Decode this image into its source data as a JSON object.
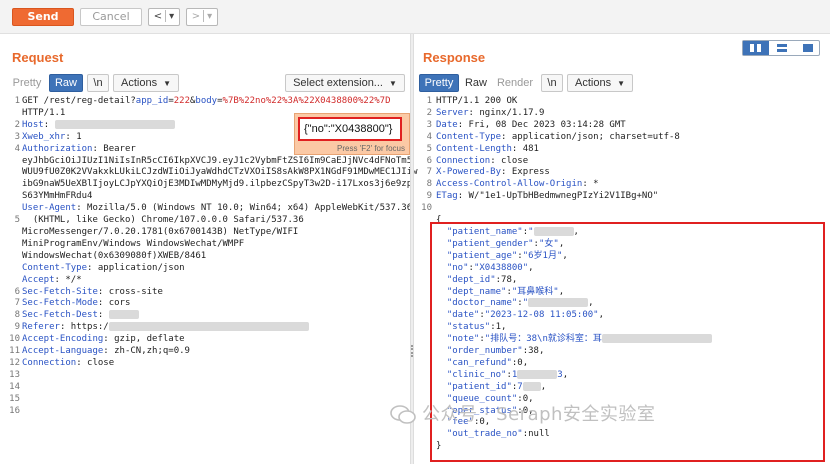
{
  "toolbar": {
    "send_label": "Send",
    "cancel_label": "Cancel",
    "back_label": "<",
    "back_menu_label": "▾",
    "forward_label": ">",
    "forward_menu_label": "▾"
  },
  "request": {
    "title": "Request",
    "tabs": {
      "pretty": "Pretty",
      "raw": "Raw",
      "newline": "\\n",
      "actions": "Actions"
    },
    "select_extension": "Select extension...",
    "tooltip_hint": "Press 'F2' for focus",
    "highlight_text": "{\"no\":\"X0438800\"}",
    "line_numbers": [
      "1",
      "",
      "2",
      "3",
      "4",
      "",
      "",
      "",
      "",
      "",
      "5",
      "",
      "",
      "",
      "",
      "",
      "6",
      "7",
      "8",
      "9",
      "10",
      "11",
      "12",
      "13",
      "14",
      "15",
      "16"
    ],
    "line1_method": "GET /rest/reg-detail?",
    "line1_p1k": "app_id",
    "line1_eq1": "=",
    "line1_p1v": "222",
    "line1_amp": "&",
    "line1_p2k": "body",
    "line1_eq2": "=",
    "line1_p2v": "%7B%22no%22%3A%22X0438800%22%7D",
    "line1b": "HTTP/1.1",
    "host_key": "Host",
    "xweb_key": "Xweb_xhr",
    "xweb_val": " 1",
    "auth_key": "Authorization",
    "auth_val": " Bearer",
    "auth_l2": "eyJhbGciOiJIUzI1NiIsInR5cCI6IkpXVCJ9.eyJ1c2VybmFtZSI6Im9CaEJjNVc4dFNoTm5",
    "auth_l3": "WUU9fU0Z0K2VVakxkLUkiLCJzdWIiOiJyaWdhdCTzVXOiIS8sAkW8PX1NGdF91MDwMEC1JIiw",
    "auth_l4": "ibG9naW5UeXBlIjoyLCJpYXQiOjE3MDIwMDMyMjd9.ilpbezCSpyT3w2D-i17Lxos3j6e9zp",
    "auth_l5": "S63YMmHmFRdu4",
    "ua_key": "User-Agent",
    "ua_l1": " Mozilla/5.0 (Windows NT 10.0; Win64; x64) AppleWebKit/537.36",
    "ua_l2": "  (KHTML, like Gecko) Chrome/107.0.0.0 Safari/537.36",
    "ua_l3": "MicroMessenger/7.0.20.1781(0x6700143B) NetType/WIFI",
    "ua_l4": "MiniProgramEnv/Windows WindowsWechat/WMPF",
    "ua_l5": "WindowsWechat(0x6309080f)XWEB/8461",
    "ct_key": "Content-Type",
    "ct_val": " application/json",
    "accept_key": "Accept",
    "accept_val": " */*",
    "sfs_key": "Sec-Fetch-Site",
    "sfs_val": " cross-site",
    "sfm_key": "Sec-Fetch-Mode",
    "sfm_val": " cors",
    "sfd_key": "Sec-Fetch-Dest",
    "ref_key": "Referer",
    "ref_val": " https:/",
    "ae_key": "Accept-Encoding",
    "ae_val": " gzip, deflate",
    "al_key": "Accept-Language",
    "al_val": " zh-CN,zh;q=0.9",
    "conn_key": "Connection",
    "conn_val": " close"
  },
  "response": {
    "title": "Response",
    "tabs": {
      "pretty": "Pretty",
      "raw": "Raw",
      "render": "Render",
      "newline": "\\n",
      "actions": "Actions"
    },
    "line_numbers": [
      "1",
      "2",
      "3",
      "4",
      "5",
      "6",
      "7",
      "8",
      "9",
      "10",
      "",
      "",
      "",
      "",
      "",
      "",
      "",
      "",
      "",
      "",
      "",
      "",
      "",
      "",
      "",
      "",
      "",
      "",
      ""
    ],
    "status_line": "HTTP/1.1 200 OK",
    "server_key": "Server",
    "server_val": " nginx/1.17.9",
    "date_key": "Date",
    "date_val": " Fri, 08 Dec 2023 03:14:28 GMT",
    "ct_key": "Content-Type",
    "ct_val": " application/json; charset=utf-8",
    "cl_key": "Content-Length",
    "cl_val": " 481",
    "conn_key": "Connection",
    "conn_val": " close",
    "xpb_key": "X-Powered-By",
    "xpb_val": " Express",
    "acao_key": "Access-Control-Allow-Origin",
    "acao_val": " *",
    "etag_key": "ETag",
    "etag_val": " W/\"1e1-UpTbHBedmwnegPIzYi2V1IBg+NO\"",
    "body_open": "{",
    "body_close": "}",
    "json": {
      "patient_name_k": "\"patient_name\"",
      "patient_name_v": "\"",
      "patient_gender_k": "\"patient_gender\"",
      "patient_gender_v": "\"女\"",
      "patient_age_k": "\"patient_age\"",
      "patient_age_v": "\"6岁1月\"",
      "no_k": "\"no\"",
      "no_v": "\"X0438800\"",
      "dept_id_k": "\"dept_id\"",
      "dept_id_v": "78",
      "dept_name_k": "\"dept_name\"",
      "dept_name_v": "\"耳鼻喉科\"",
      "doctor_name_k": "\"doctor_name\"",
      "doctor_name_v": "\"",
      "date_k": "\"date\"",
      "date_v": "\"2023-12-08 11:05:00\"",
      "status_k": "\"status\"",
      "status_v": "1",
      "note_k": "\"note\"",
      "note_v": "\"排队号：38\\n就诊科室：耳",
      "order_number_k": "\"order_number\"",
      "order_number_v": "38",
      "can_refund_k": "\"can_refund\"",
      "can_refund_v": "0",
      "clinic_no_k": "\"clinic_no\"",
      "clinic_no_v1": "1",
      "clinic_no_v2": "3",
      "patient_id_k": "\"patient_id\"",
      "patient_id_v": "7",
      "queue_count_k": "\"queue_count\"",
      "queue_count_v": "0",
      "oper_status_k": "\"oper_status\"",
      "oper_status_v": "0",
      "fee_k": "\"fee\"",
      "fee_v": "0",
      "out_trade_no_k": "\"out_trade_no\"",
      "out_trade_no_v": "null"
    }
  },
  "watermark": "公众号 · Seraph安全实验室",
  "colors": {
    "accent": "#e8692c",
    "send": "#ef6a32",
    "highlight": "#e02020",
    "active_tab": "#3e73b8"
  }
}
